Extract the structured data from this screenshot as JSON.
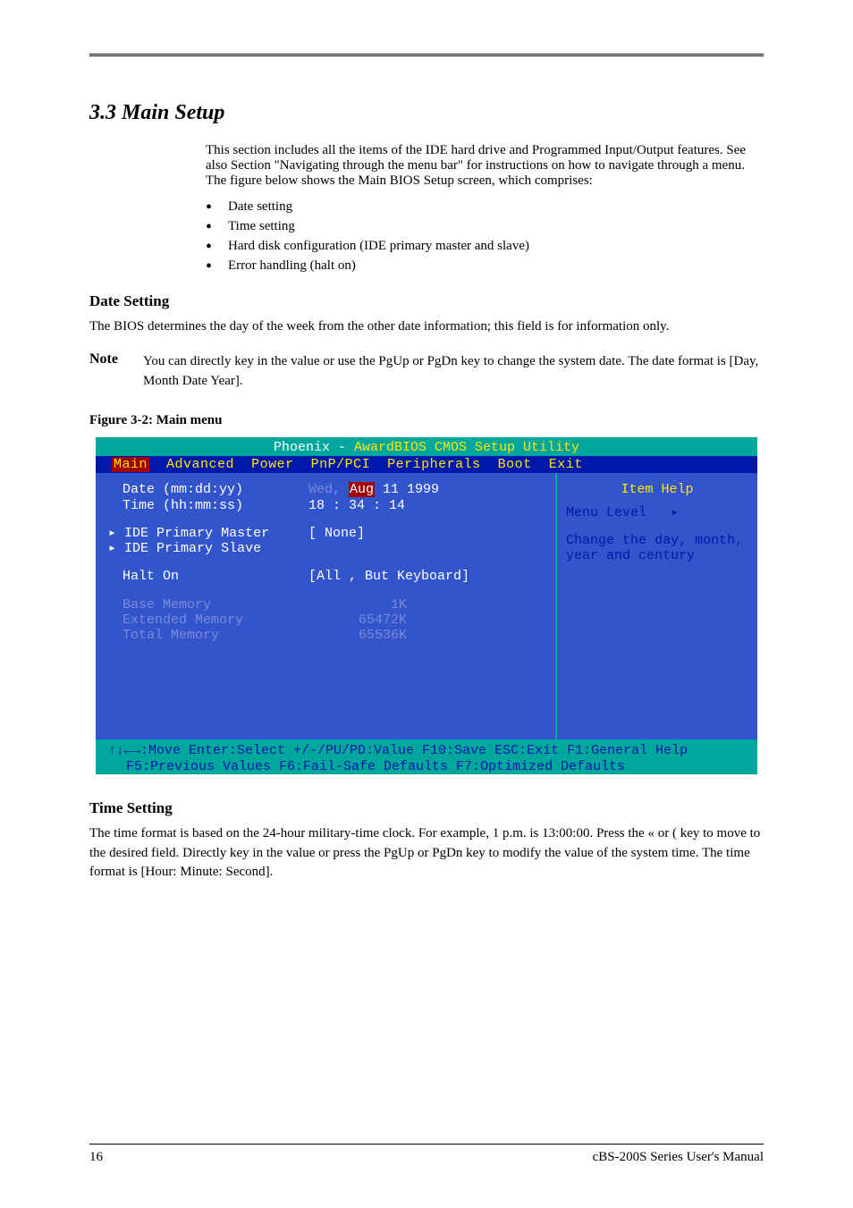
{
  "section_title": "3.3 Main Setup",
  "intro": "This section includes all the items of the IDE hard drive and Programmed Input/Output features. See also Section \"Navigating through the menu bar\" for instructions on how to navigate through a menu. The figure below shows the Main BIOS Setup screen, which comprises:",
  "bullets": [
    "Date setting",
    "Time setting",
    "Hard disk configuration (IDE primary master and slave)",
    "Error handling (halt on)"
  ],
  "subhead_date": "Date Setting",
  "date_body": "The BIOS determines the day of the week from the other date information; this field is for information only.",
  "note_label": "Note",
  "note_body": "You can directly key in the value or use the PgUp or PgDn key to change the system date. The date format is [Day, Month Date Year].",
  "figure_label": "Figure 3-2: Main menu",
  "bios": {
    "title_pre": "Phoenix - ",
    "title_hl": "A",
    "title_post": "wardBIOS CMOS Setup Utility",
    "menu": [
      "Main",
      "Advanced",
      "Power",
      "PnP/PCI",
      "Peripherals",
      "Boot",
      "Exit"
    ],
    "rows": {
      "date_label": "Date (mm:dd:yy)",
      "date_val_pre": "Wed, ",
      "date_val_hl": "Aug",
      "date_val_post": " 11 1999",
      "time_label": "Time (hh:mm:ss)",
      "time_val": "18 : 34 : 14",
      "ide_master": "IDE Primary Master",
      "ide_master_val": "[ None]",
      "ide_slave": "IDE Primary Slave",
      "halt_label": "Halt On",
      "halt_val": "[All , But Keyboard]",
      "base_label": "Base Memory",
      "base_val": "1K",
      "ext_label": "Extended Memory",
      "ext_val": "65472K",
      "total_label": "Total Memory",
      "total_val": "65536K"
    },
    "help_title": "Item Help",
    "menu_level": "Menu Level",
    "help_text": "Change the day, month, year and century",
    "footer1": "↑↓←→:Move  Enter:Select   +/-/PU/PD:Value  F10:Save   ESC:Exit  F1:General Help",
    "footer2": "F5:Previous Values    F6:Fail-Safe Defaults    F7:Optimized Defaults"
  },
  "subhead_time": "Time Setting",
  "time_body": "The time format is based on the 24-hour military-time clock. For example, 1 p.m. is 13:00:00. Press the « or ( key to move to the desired field. Directly key in the value or press the PgUp or PgDn key to modify the value of the system time. The time format is [Hour: Minute: Second].",
  "footer_left": "16",
  "footer_right": "cBS-200S Series User's Manual"
}
